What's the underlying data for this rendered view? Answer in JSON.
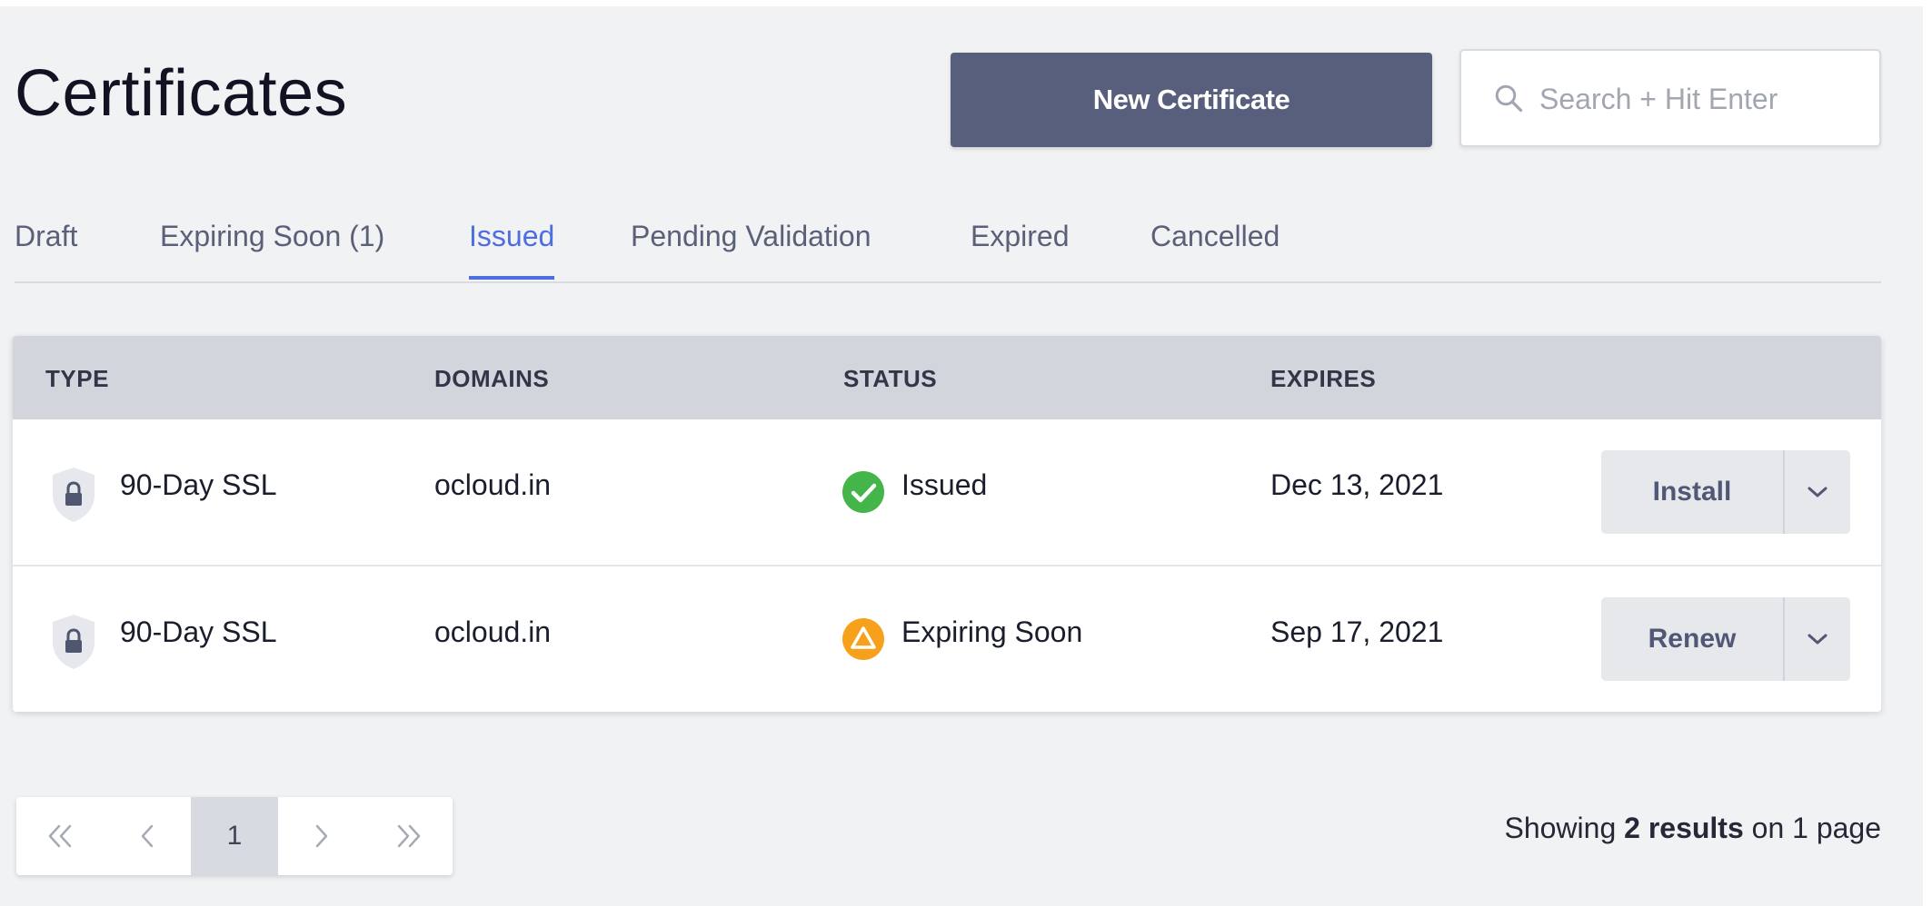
{
  "page": {
    "title": "Certificates"
  },
  "toolbar": {
    "new_certificate_label": "New Certificate",
    "search_placeholder": "Search + Hit Enter",
    "search_value": ""
  },
  "tabs": [
    {
      "label": "Draft",
      "active": false
    },
    {
      "label": "Expiring Soon (1)",
      "active": false
    },
    {
      "label": "Issued",
      "active": true
    },
    {
      "label": "Pending Validation",
      "active": false
    },
    {
      "label": "Expired",
      "active": false
    },
    {
      "label": "Cancelled",
      "active": false
    }
  ],
  "table": {
    "columns": [
      "TYPE",
      "DOMAINS",
      "STATUS",
      "EXPIRES"
    ],
    "rows": [
      {
        "type": "90-Day SSL",
        "type_icon": "lock-shield-icon",
        "domain": "ocloud.in",
        "status": "Issued",
        "status_icon": "check-circle-icon",
        "expires": "Dec 13, 2021",
        "action_label": "Install"
      },
      {
        "type": "90-Day SSL",
        "type_icon": "lock-shield-icon",
        "domain": "ocloud.in",
        "status": "Expiring Soon",
        "status_icon": "warning-triangle-icon",
        "expires": "Sep 17, 2021",
        "action_label": "Renew"
      }
    ]
  },
  "pagination": {
    "current_page": "1",
    "first_icon": "double-chevron-left-icon",
    "prev_icon": "chevron-left-icon",
    "next_icon": "chevron-right-icon",
    "last_icon": "double-chevron-right-icon"
  },
  "summary": {
    "prefix": "Showing",
    "count": "2 results",
    "suffix": "on 1 page"
  },
  "colors": {
    "accent": "#4e6de0",
    "primary_button": "#575f7d",
    "issued_green": "#44b549",
    "warning_orange": "#f7a01b",
    "header_bg": "#d2d5dc"
  }
}
